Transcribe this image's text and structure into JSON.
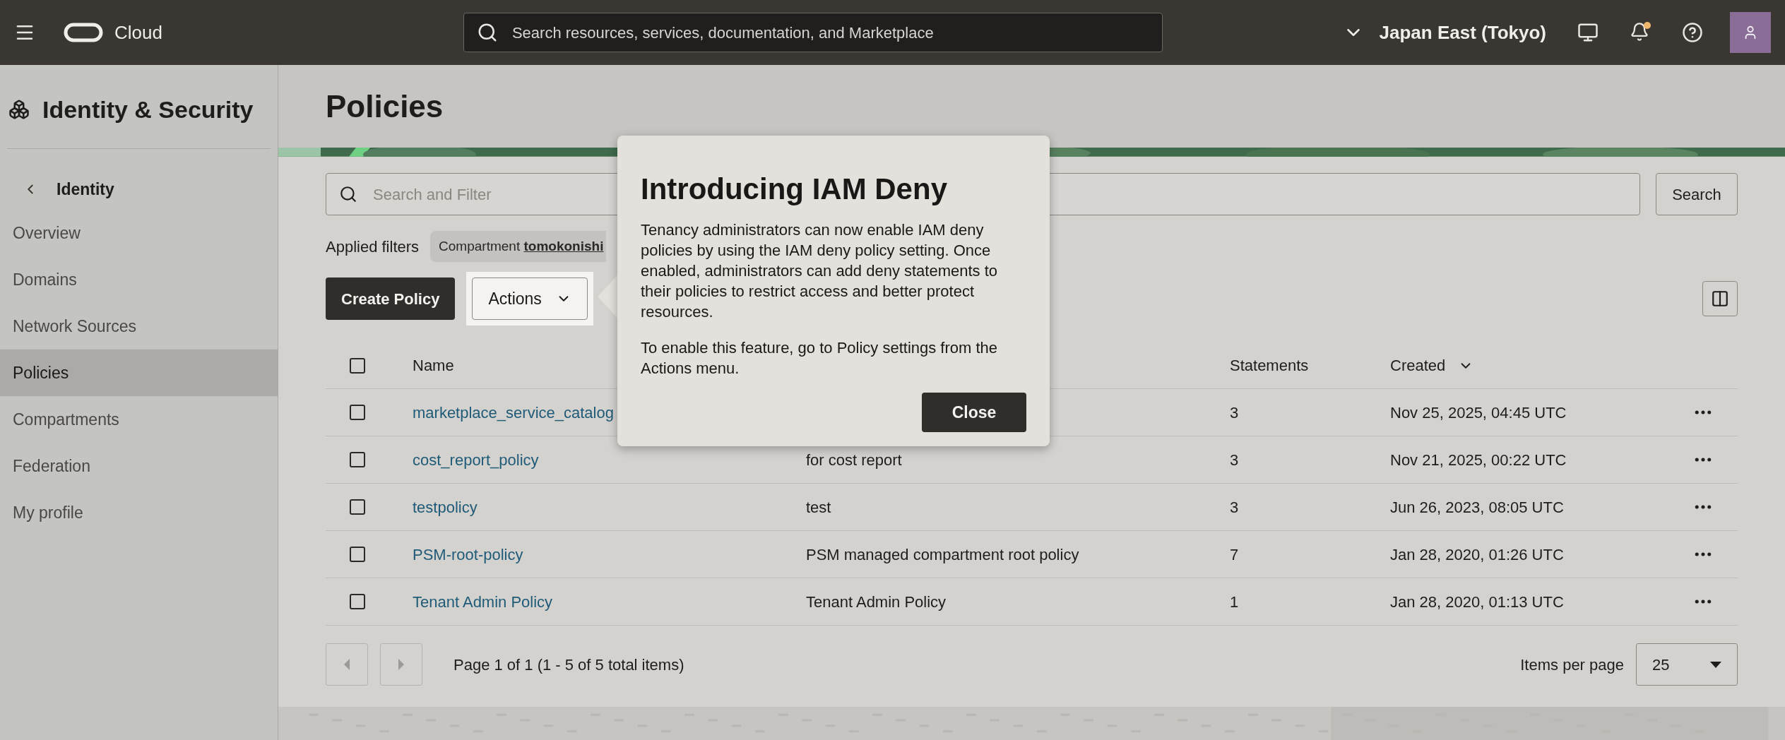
{
  "top_bar": {
    "brand": "Cloud",
    "search_placeholder": "Search resources, services, documentation, and Marketplace",
    "region": "Japan East (Tokyo)",
    "notification_dot": true
  },
  "sidebar": {
    "title": "Identity & Security",
    "back_label": "Identity",
    "items": [
      {
        "label": "Overview",
        "selected": false
      },
      {
        "label": "Domains",
        "selected": false
      },
      {
        "label": "Network Sources",
        "selected": false
      },
      {
        "label": "Policies",
        "selected": true
      },
      {
        "label": "Compartments",
        "selected": false
      },
      {
        "label": "Federation",
        "selected": false
      },
      {
        "label": "My profile",
        "selected": false
      }
    ]
  },
  "page": {
    "title": "Policies"
  },
  "filter_bar": {
    "search_placeholder": "Search and Filter",
    "search_button": "Search",
    "applied_filters_label": "Applied filters",
    "chip": {
      "label": "Compartment",
      "value": "tomokonishi"
    }
  },
  "toolbar": {
    "create_button": "Create Policy",
    "actions_button": "Actions",
    "actions_highlighted": true
  },
  "table": {
    "columns": [
      {
        "label": "Name"
      },
      {
        "label": "Statements"
      },
      {
        "label": "Created",
        "sorted": true
      }
    ],
    "all_checked": false,
    "rows": [
      {
        "name": "marketplace_service_catalog",
        "statements": "3",
        "created": "Nov 25, 2025, 04:45 UTC",
        "checked": false
      },
      {
        "name": "cost_report_policy",
        "description": "for cost report",
        "statements": "3",
        "created": "Nov 21, 2025, 00:22 UTC",
        "checked": false
      },
      {
        "name": "testpolicy",
        "description": "test",
        "statements": "3",
        "created": "Jun 26, 2023, 08:05 UTC",
        "checked": false
      },
      {
        "name": "PSM-root-policy",
        "description": "PSM managed compartment root policy",
        "statements": "7",
        "created": "Jan 28, 2020, 01:26 UTC",
        "checked": false
      },
      {
        "name": "Tenant Admin Policy",
        "description": "Tenant Admin Policy",
        "statements": "1",
        "created": "Jan 28, 2020, 01:13 UTC",
        "checked": false
      }
    ]
  },
  "pagination": {
    "summary": "Page 1 of 1 (1 - 5 of 5 total items)",
    "items_per_page_label": "Items per page",
    "items_per_page": "25"
  },
  "popup": {
    "title": "Introducing IAM Deny",
    "paragraphs": [
      "Tenancy administrators can now enable IAM deny policies by using the IAM deny policy setting. Once enabled, administrators can add deny statements to their policies to restrict access and better protect resources.",
      "To enable this feature, go to Policy settings from the Actions menu."
    ],
    "close_button": "Close"
  }
}
